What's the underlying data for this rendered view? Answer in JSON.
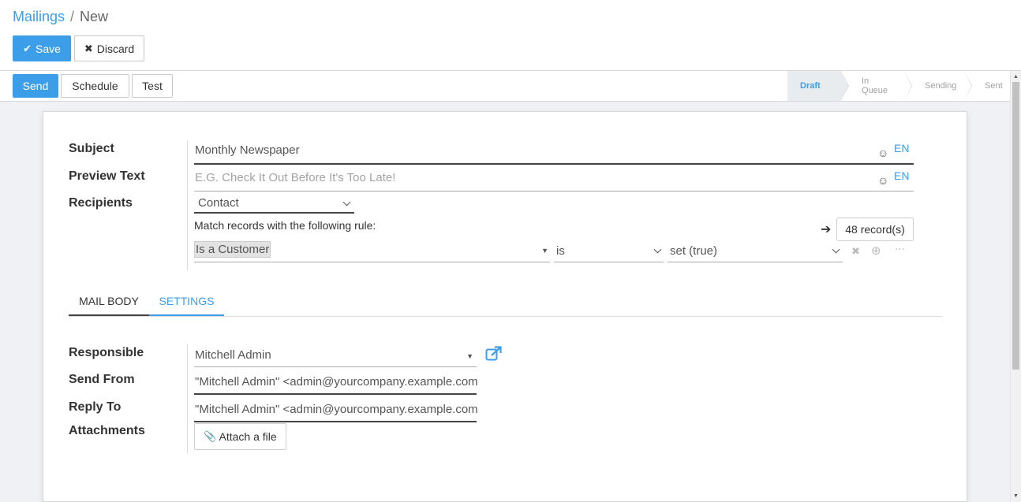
{
  "breadcrumb": {
    "parent": "Mailings",
    "separator": "/",
    "current": "New"
  },
  "actions": {
    "save_label": "Save",
    "discard_label": "Discard"
  },
  "statusbar": {
    "buttons": {
      "send": "Send",
      "schedule": "Schedule",
      "test": "Test"
    },
    "stages": [
      {
        "label": "Draft",
        "active": true
      },
      {
        "label": "In Queue",
        "active": false
      },
      {
        "label": "Sending",
        "active": false
      },
      {
        "label": "Sent",
        "active": false
      }
    ]
  },
  "form": {
    "subject": {
      "label": "Subject",
      "value": "Monthly Newspaper",
      "lang": "EN"
    },
    "preview_text": {
      "label": "Preview Text",
      "placeholder": "E.G. Check It Out Before It's Too Late!",
      "lang": "EN"
    },
    "recipients": {
      "label": "Recipients",
      "value": "Contact"
    },
    "rule": {
      "intro": "Match records with the following rule:",
      "records_count": "48 record(s)",
      "field": "Is a Customer",
      "operator": "is",
      "value": "set (true)"
    },
    "tabs": [
      {
        "label": "MAIL BODY",
        "active": false
      },
      {
        "label": "SETTINGS",
        "active": true
      }
    ],
    "responsible": {
      "label": "Responsible",
      "value": "Mitchell Admin"
    },
    "send_from": {
      "label": "Send From",
      "value": "\"Mitchell Admin\" <admin@yourcompany.example.com>"
    },
    "reply_to": {
      "label": "Reply To",
      "value": "\"Mitchell Admin\" <admin@yourcompany.example.com>"
    },
    "attachments": {
      "label": "Attachments",
      "button": "Attach a file"
    }
  },
  "colors": {
    "accent": "#3c9ee8",
    "background": "#f0f1f4"
  }
}
